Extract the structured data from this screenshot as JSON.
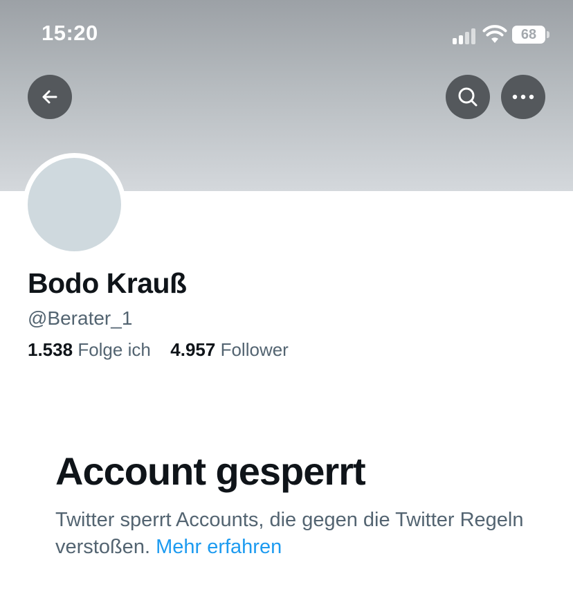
{
  "status_bar": {
    "time": "15:20",
    "battery": "68"
  },
  "header": {
    "back_icon": "arrow-left-icon",
    "search_icon": "search-icon",
    "more_icon": "more-horizontal-icon"
  },
  "profile": {
    "name": "Bodo Krauß",
    "handle": "@Berater_1",
    "following_count": "1.538",
    "following_label": "Folge ich",
    "followers_count": "4.957",
    "followers_label": "Follower"
  },
  "suspended": {
    "title": "Account gesperrt",
    "text": "Twitter sperrt Accounts, die gegen die Twitter Regeln verstoßen.",
    "link": "Mehr erfahren"
  },
  "colors": {
    "link": "#1d9bf0",
    "secondary_text": "#536471",
    "primary_text": "#0f1419",
    "avatar_placeholder": "#cfd9de"
  }
}
